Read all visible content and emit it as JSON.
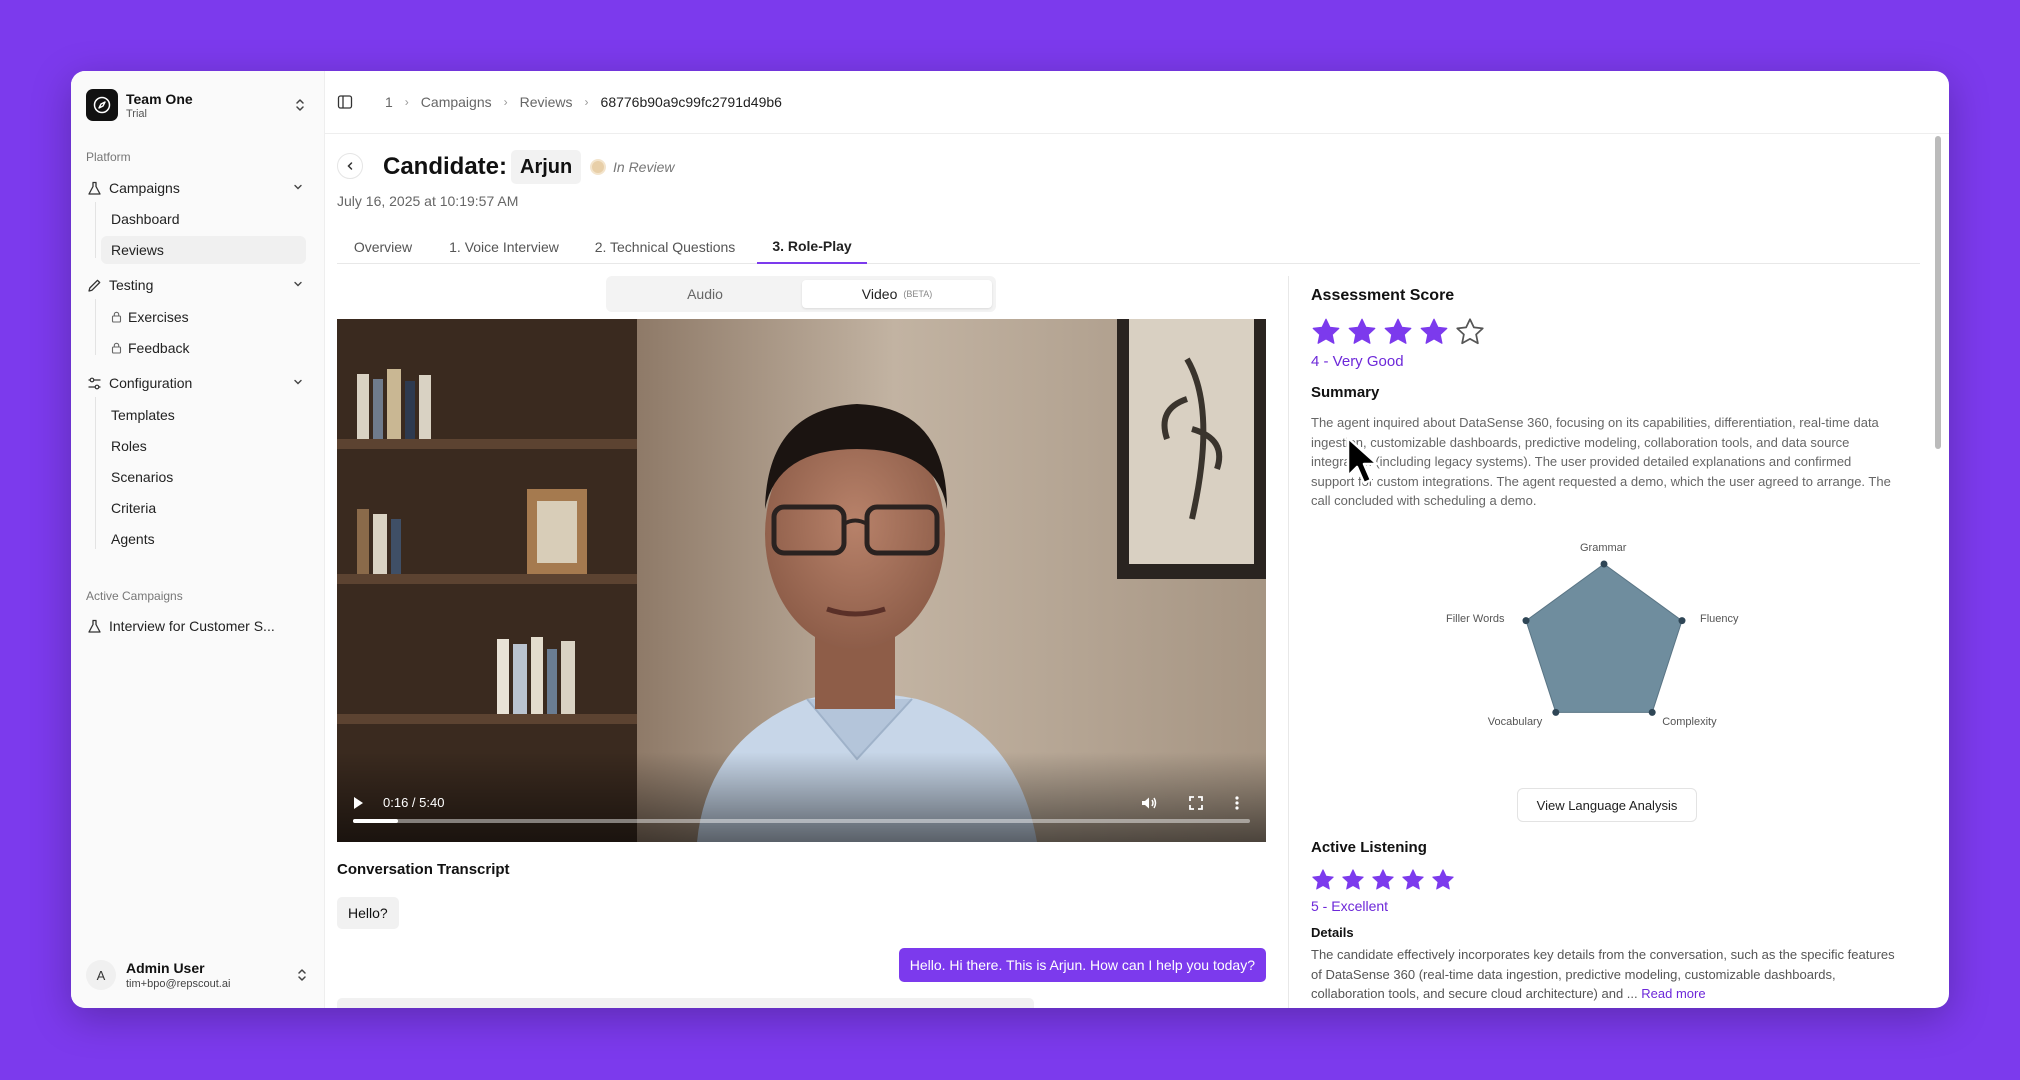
{
  "sidebar": {
    "team": {
      "name": "Team One",
      "plan": "Trial"
    },
    "platform_label": "Platform",
    "groups": [
      {
        "label": "Campaigns",
        "icon": "flask-icon",
        "items": [
          "Dashboard",
          "Reviews"
        ]
      },
      {
        "label": "Testing",
        "icon": "pencil-icon",
        "items": [
          "Exercises",
          "Feedback"
        ]
      },
      {
        "label": "Configuration",
        "icon": "sliders-icon",
        "items": [
          "Templates",
          "Roles",
          "Scenarios",
          "Criteria",
          "Agents"
        ]
      }
    ],
    "active_item": "Reviews",
    "active_campaigns_label": "Active Campaigns",
    "active_campaign": "Interview for Customer S...",
    "user": {
      "initial": "A",
      "name": "Admin User",
      "email": "tim+bpo@repscout.ai"
    }
  },
  "breadcrumb": [
    "1",
    "Campaigns",
    "Reviews",
    "68776b90a9c99fc2791d49b6"
  ],
  "candidate": {
    "label": "Candidate:",
    "name": "Arjun",
    "status": "In Review",
    "date": "July 16, 2025 at 10:19:57 AM"
  },
  "tabs": [
    "Overview",
    "1. Voice Interview",
    "2. Technical Questions",
    "3. Role-Play"
  ],
  "active_tab": "3. Role-Play",
  "media_toggle": {
    "audio": "Audio",
    "video": "Video",
    "video_badge": "(BETA)",
    "selected": "Video"
  },
  "video": {
    "time": "0:16 / 5:40",
    "progress": 0.05
  },
  "transcript": {
    "title": "Conversation Transcript",
    "messages": [
      {
        "side": "user",
        "text": "Hello?"
      },
      {
        "side": "agent",
        "text": "Hello. Hi there. This is Arjun. How can I help you today?"
      }
    ]
  },
  "assessment": {
    "title": "Assessment Score",
    "stars": 4,
    "max_stars": 5,
    "score_label": "4 - Very Good",
    "summary_title": "Summary",
    "summary": "The agent inquired about DataSense 360, focusing on its capabilities, differentiation, real-time data ingestion, customizable dashboards, predictive modeling, collaboration tools, and data source integration (including legacy systems). The user provided detailed explanations and confirmed support for custom integrations. The agent requested a demo, which the user agreed to arrange. The call concluded with scheduling a demo.",
    "radar": {
      "axes": [
        "Grammar",
        "Fluency",
        "Complexity",
        "Vocabulary",
        "Filler Words"
      ],
      "values": [
        100,
        100,
        100,
        100,
        100
      ],
      "max": 100,
      "fill_color": "#6f8d9e"
    },
    "view_analysis_button": "View Language Analysis"
  },
  "active_listening": {
    "title": "Active Listening",
    "stars": 5,
    "max_stars": 5,
    "score_label": "5 - Excellent",
    "details_title": "Details",
    "details": "The candidate effectively incorporates key details from the conversation, such as the specific features of DataSense 360 (real-time data ingestion, predictive modeling, customizable dashboards, collaboration tools, and secure cloud architecture) and ...",
    "read_more": "Read more"
  },
  "colors": {
    "accent": "#7c3aed",
    "background": "#7c3aed"
  }
}
